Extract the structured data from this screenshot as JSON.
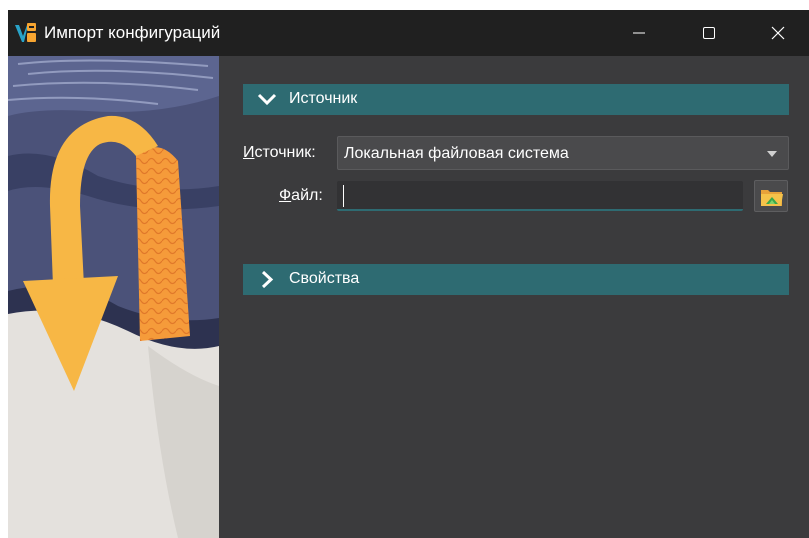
{
  "window": {
    "title": "Импорт конфигураций",
    "controls": {
      "minimize": "minimize-icon",
      "maximize": "maximize-icon",
      "close": "close-icon"
    }
  },
  "sections": {
    "source": {
      "label": "Источник",
      "expanded": true
    },
    "properties": {
      "label": "Свойства",
      "expanded": false
    }
  },
  "form": {
    "source_label_ul": "И",
    "source_label_rest": "сточник:",
    "source_value": "Локальная файловая система",
    "file_label_ul": "Ф",
    "file_label_rest": "айл:",
    "file_value": ""
  },
  "colors": {
    "titlebar": "#202020",
    "panel": "#3b3b3d",
    "accent": "#2e6b72",
    "arrow": "#f7b745"
  }
}
